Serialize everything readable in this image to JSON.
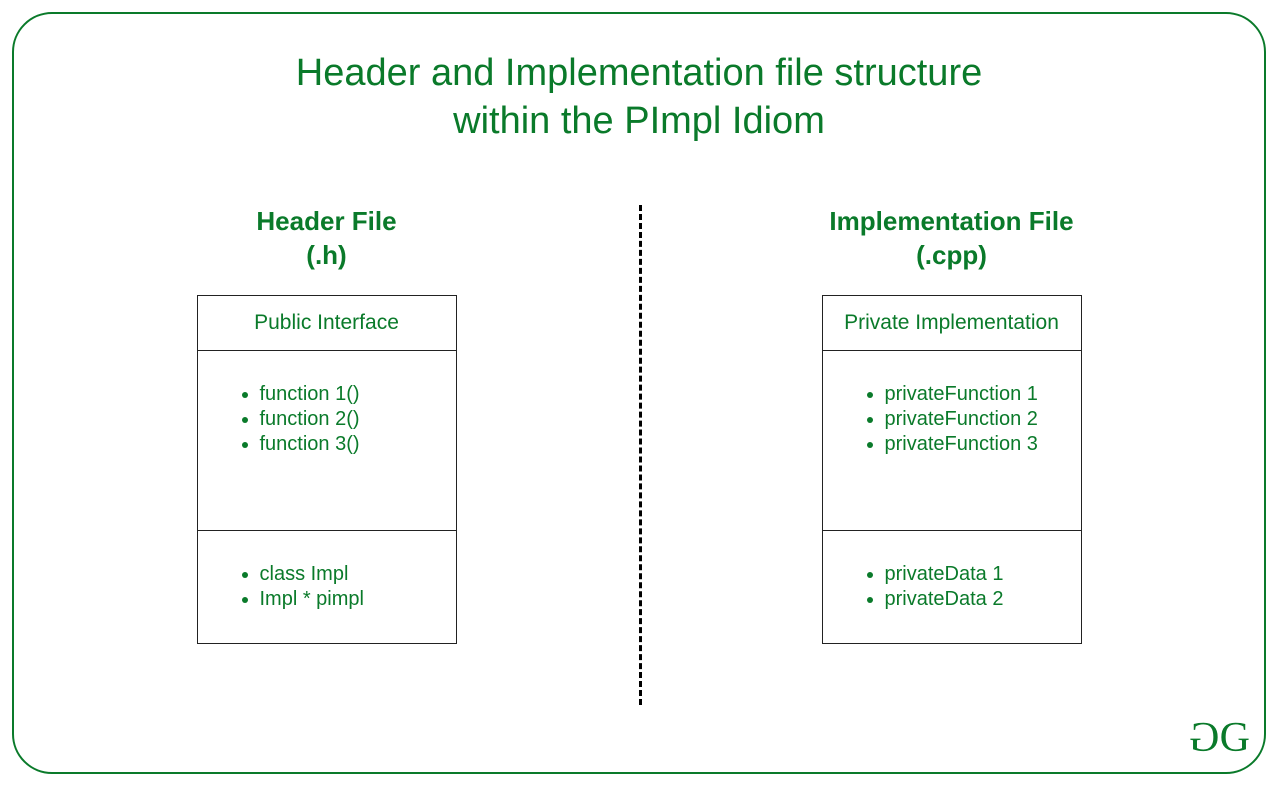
{
  "title_line1": "Header and Implementation file structure",
  "title_line2": "within the PImpl Idiom",
  "left": {
    "heading_line1": "Header File",
    "heading_line2": "(.h)",
    "box_header": "Public Interface",
    "section1": [
      "function 1()",
      "function 2()",
      "function 3()"
    ],
    "section2": [
      " class Impl",
      "Impl * pimpl"
    ]
  },
  "right": {
    "heading_line1": "Implementation File",
    "heading_line2": "(.cpp)",
    "box_header": "Private Implementation",
    "section1": [
      "privateFunction 1",
      "privateFunction 2",
      "privateFunction 3"
    ],
    "section2": [
      "privateData 1",
      "privateData 2"
    ]
  },
  "logo": {
    "g1": "G",
    "g2": "G"
  }
}
